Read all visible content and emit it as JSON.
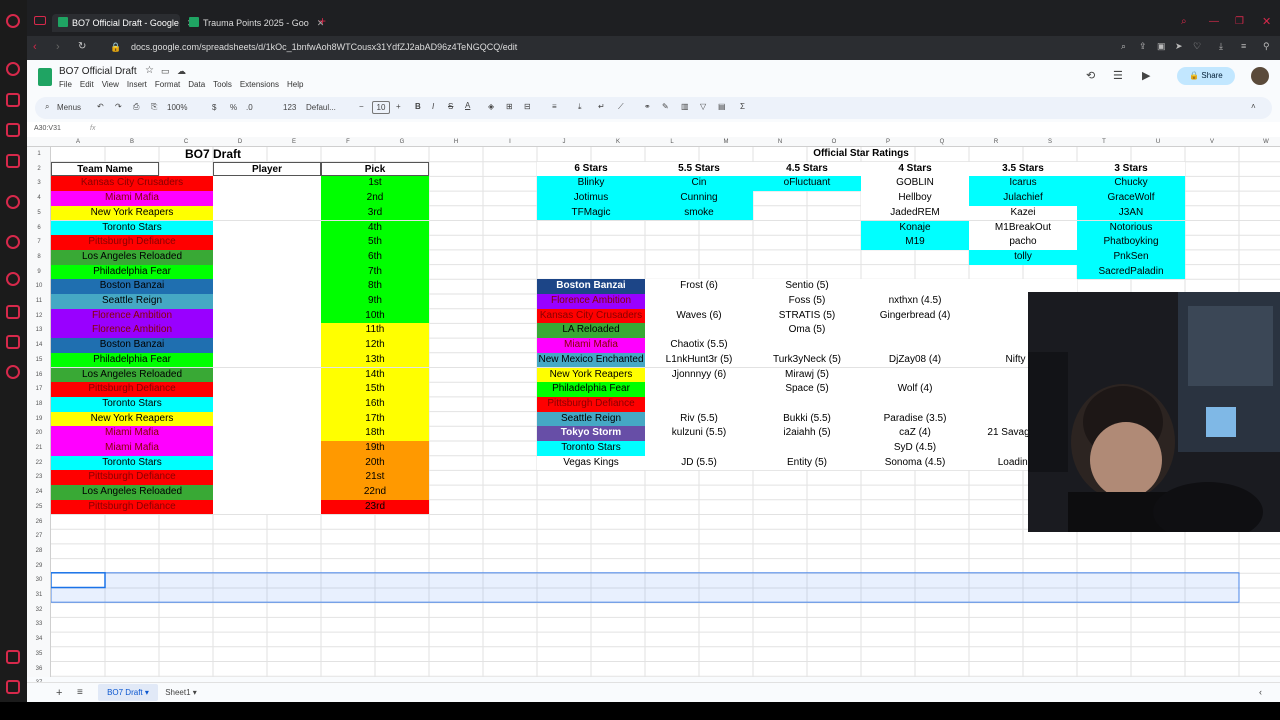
{
  "browser": {
    "tabs": [
      {
        "title": "BO7 Official Draft - Google",
        "active": true
      },
      {
        "title": "Trauma Points 2025 - Goo",
        "active": false
      }
    ],
    "url": "docs.google.com/spreadsheets/d/1kOc_1bnfwAoh8WTCousx31YdfZJ2abAD96z4TeNGQCQ/edit"
  },
  "doc": {
    "title": "BO7 Official Draft",
    "menus": [
      "File",
      "Edit",
      "View",
      "Insert",
      "Format",
      "Data",
      "Tools",
      "Extensions",
      "Help"
    ],
    "share": "Share"
  },
  "toolbar": {
    "search": "Menus",
    "zoom": "100%",
    "percent": "%",
    "decimal": ".0",
    "num": "123",
    "font": "Defaul...",
    "size": "10"
  },
  "formula": {
    "cellref": "A30:V31",
    "fx": "fx"
  },
  "columns": [
    "A",
    "B",
    "C",
    "D",
    "E",
    "F",
    "G",
    "H",
    "I",
    "J",
    "K",
    "L",
    "M",
    "N",
    "O",
    "P",
    "Q",
    "R",
    "S",
    "T",
    "U",
    "V",
    "W"
  ],
  "rows": [
    "1",
    "2",
    "3",
    "4",
    "5",
    "6",
    "7",
    "8",
    "9",
    "10",
    "11",
    "12",
    "13",
    "14",
    "15",
    "16",
    "17",
    "18",
    "19",
    "20",
    "21",
    "22",
    "23",
    "24",
    "25",
    "26",
    "27",
    "28",
    "29",
    "30",
    "31",
    "32",
    "33",
    "34",
    "35",
    "36",
    "37",
    "38",
    "39"
  ],
  "colors": {
    "red": "#ff0000",
    "magenta": "#ff00ff",
    "yellow": "#ffff00",
    "cyan": "#00ffff",
    "green": "#39a935",
    "lightgreen": "#00ff00",
    "blue": "#1f6fb0",
    "purple": "#9900ff",
    "orange": "#ff9900",
    "slate": "#45a8c4",
    "navy": "#1c4587",
    "darkpurple": "#674ea7"
  },
  "draft": {
    "title": "BO7 Draft",
    "headers": {
      "team": "Team Name",
      "player": "Player",
      "pick": "Pick"
    },
    "teams": [
      {
        "name": "Kansas City Crusaders",
        "color": "#ff0000"
      },
      {
        "name": "Miami Mafia",
        "color": "#ff00ff"
      },
      {
        "name": "New York Reapers",
        "color": "#ffff00"
      },
      {
        "name": "Toronto Stars",
        "color": "#00ffff"
      },
      {
        "name": "Pittsburgh Defiance",
        "color": "#ff0000"
      },
      {
        "name": "Los Angeles Reloaded",
        "color": "#39a935"
      },
      {
        "name": "Philadelphia Fear",
        "color": "#00ff00"
      },
      {
        "name": "Boston Banzai",
        "color": "#1f6fb0"
      },
      {
        "name": "Seattle Reign",
        "color": "#45a8c4"
      },
      {
        "name": "Florence Ambition",
        "color": "#9900ff"
      },
      {
        "name": "Florence Ambition",
        "color": "#9900ff"
      },
      {
        "name": "Boston Banzai",
        "color": "#1f6fb0"
      },
      {
        "name": "Philadelphia Fear",
        "color": "#00ff00"
      },
      {
        "name": "Los Angeles Reloaded",
        "color": "#39a935"
      },
      {
        "name": "Pittsburgh Defiance",
        "color": "#ff0000"
      },
      {
        "name": "Toronto Stars",
        "color": "#00ffff"
      },
      {
        "name": "New York Reapers",
        "color": "#ffff00"
      },
      {
        "name": "Miami Mafia",
        "color": "#ff00ff"
      },
      {
        "name": "Miami Mafia",
        "color": "#ff00ff"
      },
      {
        "name": "Toronto Stars",
        "color": "#00ffff"
      },
      {
        "name": "Pittsburgh Defiance",
        "color": "#ff0000"
      },
      {
        "name": "Los Angeles Reloaded",
        "color": "#39a935"
      },
      {
        "name": "Pittsburgh Defiance",
        "color": "#ff0000"
      }
    ],
    "picks": [
      {
        "label": "1st",
        "color": "#00ff00"
      },
      {
        "label": "2nd",
        "color": "#00ff00"
      },
      {
        "label": "3rd",
        "color": "#00ff00"
      },
      {
        "label": "4th",
        "color": "#00ff00"
      },
      {
        "label": "5th",
        "color": "#00ff00"
      },
      {
        "label": "6th",
        "color": "#00ff00"
      },
      {
        "label": "7th",
        "color": "#00ff00"
      },
      {
        "label": "8th",
        "color": "#00ff00"
      },
      {
        "label": "9th",
        "color": "#00ff00"
      },
      {
        "label": "10th",
        "color": "#00ff00"
      },
      {
        "label": "11th",
        "color": "#ffff00"
      },
      {
        "label": "12th",
        "color": "#ffff00"
      },
      {
        "label": "13th",
        "color": "#ffff00"
      },
      {
        "label": "14th",
        "color": "#ffff00"
      },
      {
        "label": "15th",
        "color": "#ffff00"
      },
      {
        "label": "16th",
        "color": "#ffff00"
      },
      {
        "label": "17th",
        "color": "#ffff00"
      },
      {
        "label": "18th",
        "color": "#ffff00"
      },
      {
        "label": "19th",
        "color": "#ff9900"
      },
      {
        "label": "20th",
        "color": "#ff9900"
      },
      {
        "label": "21st",
        "color": "#ff9900"
      },
      {
        "label": "22nd",
        "color": "#ff9900"
      },
      {
        "label": "23rd",
        "color": "#ff0000"
      }
    ]
  },
  "ratings": {
    "title": "Official Star Ratings",
    "columns": [
      {
        "header": "6 Stars",
        "players": [
          "Blinky",
          "Jotimus",
          "TFMagic"
        ]
      },
      {
        "header": "5.5 Stars",
        "players": [
          "Cin",
          "Cunning",
          "smoke"
        ]
      },
      {
        "header": "4.5 Stars",
        "players": [
          "oFluctuant"
        ]
      },
      {
        "header": "4 Stars",
        "players": [
          "GOBLIN",
          "Hellboy",
          "JadedREM",
          "Konaje",
          "M19"
        ]
      },
      {
        "header": "3.5 Stars",
        "players": [
          "Icarus",
          "Julachief",
          "Kazei",
          "M1BreakOut",
          "pacho",
          "tolly"
        ]
      },
      {
        "header": "3 Stars",
        "players": [
          "Chucky",
          "GraceWolf",
          "J3AN",
          "Notorious",
          "Phatboyking",
          "PnkSen",
          "SacredPaladin"
        ]
      }
    ]
  },
  "rosters": [
    {
      "team": "Boston Banzai",
      "color": "#1c4587",
      "picks": [
        "Frost (6)",
        "Sentio (5)",
        "",
        ""
      ]
    },
    {
      "team": "Florence Ambition",
      "color": "#9900ff",
      "picks": [
        "",
        "Foss (5)",
        "nxthxn (4.5)",
        ""
      ]
    },
    {
      "team": "Kansas City Crusaders",
      "color": "#ff0000",
      "picks": [
        "Waves (6)",
        "STRATIS (5)",
        "Gingerbread (4)",
        ""
      ]
    },
    {
      "team": "LA Reloaded",
      "color": "#39a935",
      "picks": [
        "",
        "Oma (5)",
        "",
        ""
      ]
    },
    {
      "team": "Miami Mafia",
      "color": "#ff00ff",
      "picks": [
        "Chaotix (5.5)",
        "",
        "",
        ""
      ]
    },
    {
      "team": "New Mexico Enchanted",
      "color": "#45a8c4",
      "picks": [
        "L1nkHunt3r (5)",
        "Turk3yNeck (5)",
        "DjZay08 (4)",
        "Nifty (3)"
      ]
    },
    {
      "team": "New York Reapers",
      "color": "#ffff00",
      "picks": [
        "Jjonnnyy (6)",
        "Mirawj (5)",
        "",
        ""
      ]
    },
    {
      "team": "Philadelphia Fear",
      "color": "#00ff00",
      "picks": [
        "",
        "Space (5)",
        "Wolf (4)",
        ""
      ]
    },
    {
      "team": "Pittsburgh Defiance",
      "color": "#ff0000",
      "picks": [
        "",
        "",
        "",
        ""
      ]
    },
    {
      "team": "Seattle Reign",
      "color": "#45a8c4",
      "picks": [
        "Riv (5.5)",
        "Bukki (5.5)",
        "Paradise (3.5)",
        ""
      ]
    },
    {
      "team": "Tokyo Storm",
      "color": "#674ea7",
      "picks": [
        "kulzuni (5.5)",
        "i2aiahh (5)",
        "caZ (4)",
        "21 Savage (3.5)"
      ]
    },
    {
      "team": "Toronto Stars",
      "color": "#00ffff",
      "picks": [
        "",
        "",
        "SyD (4.5)",
        ""
      ]
    },
    {
      "team": "Vegas Kings",
      "color": "#ffffff",
      "picks": [
        "JD (5.5)",
        "Entity (5)",
        "Sonoma (4.5)",
        "Loading (3)"
      ]
    }
  ],
  "sheets": [
    {
      "name": "BO7 Draft",
      "active": true
    },
    {
      "name": "Sheet1",
      "active": false
    }
  ]
}
